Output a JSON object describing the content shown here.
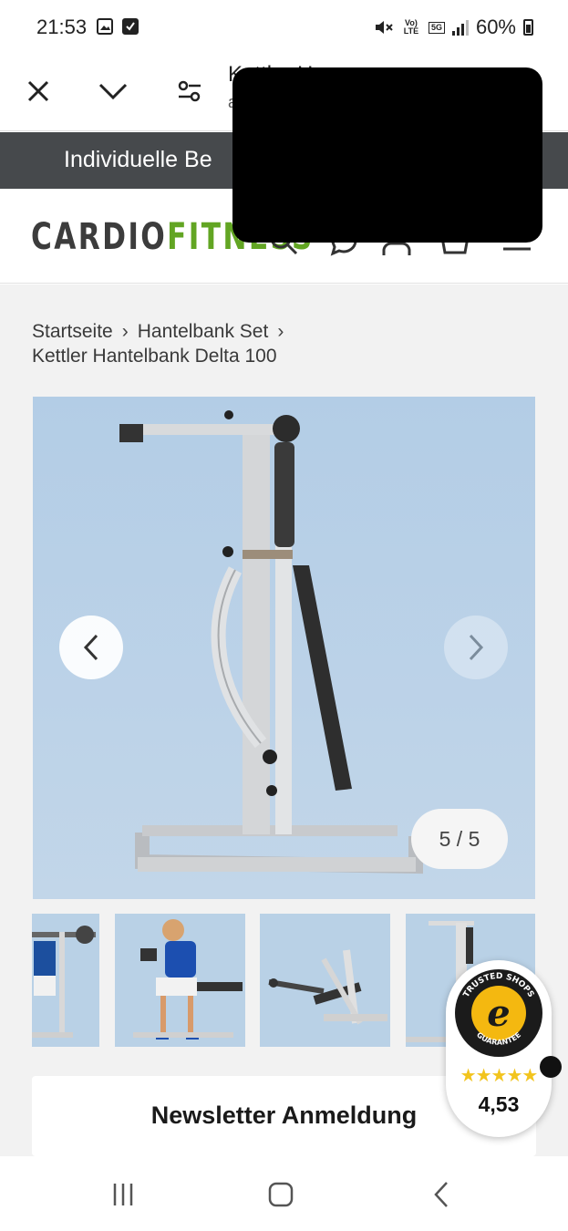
{
  "status_bar": {
    "time": "21:53",
    "battery": "60%",
    "volte": "Vo) LTE",
    "network": "5G"
  },
  "browser": {
    "title": "Kettler H",
    "subtitle": "a"
  },
  "promo": {
    "text": "Individuelle Be"
  },
  "header": {
    "logo_part1": "CARDIO",
    "logo_part2": "FITNESS",
    "icons": [
      "search-icon",
      "chat-icon",
      "account-icon",
      "cart-icon",
      "menu-icon"
    ]
  },
  "breadcrumb": {
    "items": [
      "Startseite",
      "Hantelbank Set"
    ],
    "current": "Kettler Hantelbank Delta 100"
  },
  "gallery": {
    "counter": "5 / 5"
  },
  "newsletter": {
    "label": "Newsletter Anmeldung"
  },
  "trusted_shops": {
    "seal_text": "TRUSTED SHOPS GUARANTEE",
    "rating": "4,53",
    "stars": "★★★★★"
  },
  "colors": {
    "promo_bg": "#46494c",
    "logo_gray": "#3c3c3c",
    "logo_green": "#62a523",
    "gallery_bg": "#b6cfe6"
  }
}
